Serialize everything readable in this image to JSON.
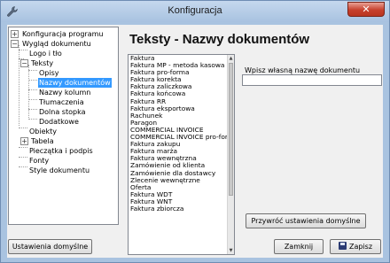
{
  "window": {
    "title": "Konfiguracja",
    "close_glyph": "✕",
    "icon": "wrench-icon"
  },
  "tree": {
    "items": [
      {
        "label": "Konfiguracja programu",
        "expander": "+"
      },
      {
        "label": "Wygląd dokumentu",
        "expander": "−"
      },
      {
        "label": "Logo i tło"
      },
      {
        "label": "Teksty",
        "expander": "−"
      },
      {
        "label": "Opisy"
      },
      {
        "label": "Nazwy dokumentów",
        "selected": true
      },
      {
        "label": "Nazwy kolumn"
      },
      {
        "label": "Tłumaczenia"
      },
      {
        "label": "Dolna stopka"
      },
      {
        "label": "Dodatkowe"
      },
      {
        "label": "Obiekty"
      },
      {
        "label": "Tabela",
        "expander": "+"
      },
      {
        "label": "Pieczątka i podpis"
      },
      {
        "label": "Fonty"
      },
      {
        "label": "Style dokumentu"
      }
    ]
  },
  "heading": "Teksty - Nazwy dokumentów",
  "documents": [
    "Faktura",
    "Faktura MP - metoda kasowa",
    "Faktura pro-forma",
    "Faktura korekta",
    "Faktura zaliczkowa",
    "Faktura końcowa",
    "Faktura RR",
    "Faktura eksportowa",
    "Rachunek",
    "Paragon",
    "COMMERCIAL INVOICE",
    "COMMERCIAL INVOICE pro-form",
    "Faktura zakupu",
    "Faktura marża",
    "Faktura wewnętrzna",
    "Zamówienie od klienta",
    "Zamówienie dla dostawcy",
    "Zlecenie wewnętrzne",
    "Oferta",
    "Faktura WDT",
    "Faktura WNT",
    "Faktura zbiorcza"
  ],
  "name_field": {
    "label": "Wpisz własną nazwę dokumentu",
    "value": ""
  },
  "buttons": {
    "reset": "Przywróć ustawienia domyślne",
    "defaults": "Ustawienia domyślne",
    "close": "Zamknij",
    "save": "Zapisz"
  },
  "colors": {
    "selection": "#3399ff",
    "frame": "#a9c3e0",
    "close_button": "#c7402c"
  }
}
